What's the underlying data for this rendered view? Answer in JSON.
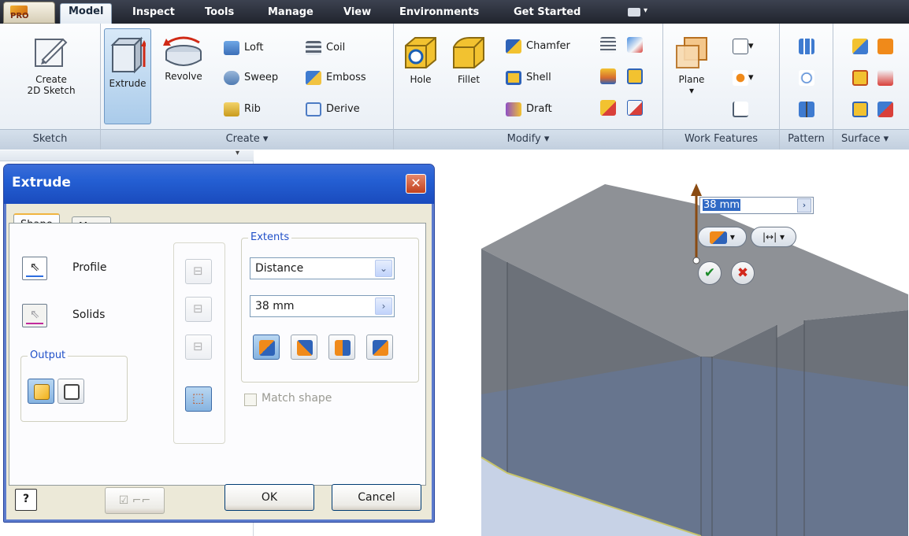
{
  "app": {
    "badge": "PRO"
  },
  "ribbon": {
    "tabs": [
      "Model",
      "Inspect",
      "Tools",
      "Manage",
      "View",
      "Environments",
      "Get Started"
    ],
    "active_tab": "Model",
    "sketch_panel": {
      "title": "Sketch",
      "create_2d_sketch": [
        "Create",
        "2D Sketch"
      ]
    },
    "create_panel": {
      "title": "Create",
      "extrude": "Extrude",
      "revolve": "Revolve",
      "loft": "Loft",
      "sweep": "Sweep",
      "rib": "Rib",
      "coil": "Coil",
      "emboss": "Emboss",
      "derive": "Derive"
    },
    "modify_panel": {
      "title": "Modify",
      "hole": "Hole",
      "fillet": "Fillet",
      "chamfer": "Chamfer",
      "shell": "Shell",
      "draft": "Draft"
    },
    "work_features_panel": {
      "title": "Work Features",
      "plane": "Plane"
    },
    "pattern_panel": {
      "title": "Pattern"
    },
    "surface_panel": {
      "title": "Surface"
    },
    "dropdown_caret": "▾"
  },
  "dialog": {
    "title": "Extrude",
    "close_glyph": "✕",
    "tabs": [
      "Shape",
      "More"
    ],
    "active_tab": "Shape",
    "profile_label": "Profile",
    "solids_label": "Solids",
    "output_group_label": "Output",
    "extents_group_label": "Extents",
    "extents_type": "Distance",
    "distance_value": "38 mm",
    "match_shape_label": "Match shape",
    "match_shape_checked": false,
    "ok_label": "OK",
    "cancel_label": "Cancel",
    "help_glyph": "?"
  },
  "viewport": {
    "distance_input_value": "38 mm",
    "ok_glyph": "✔",
    "cancel_glyph": "✖",
    "colors": {
      "top_face": "#8e9196",
      "left_face": "#737880",
      "front_face": "#6c7179",
      "preview_tint": "#5f7fb8",
      "edge_highlight": "#c7c46a",
      "arrow": "#8a4b12"
    }
  }
}
